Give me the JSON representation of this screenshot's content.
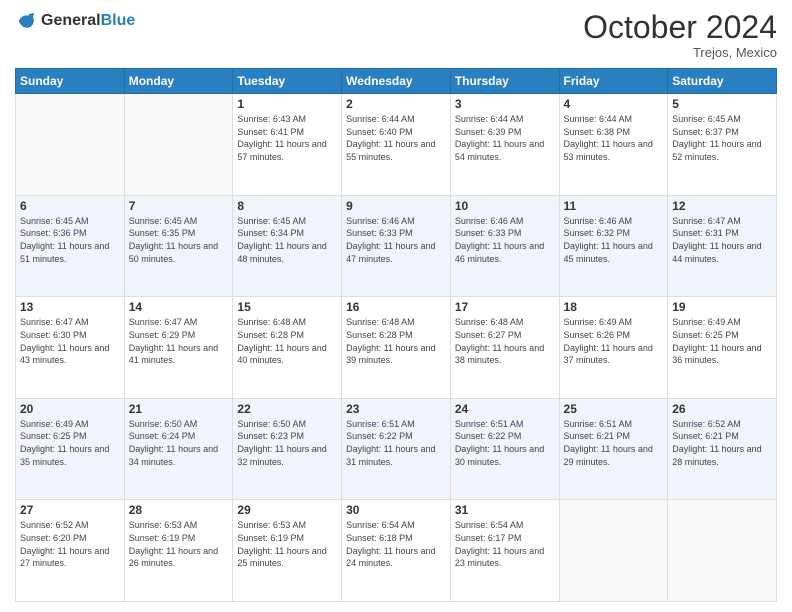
{
  "logo": {
    "general": "General",
    "blue": "Blue"
  },
  "header": {
    "month": "October 2024",
    "location": "Trejos, Mexico"
  },
  "weekdays": [
    "Sunday",
    "Monday",
    "Tuesday",
    "Wednesday",
    "Thursday",
    "Friday",
    "Saturday"
  ],
  "weeks": [
    [
      {
        "day": "",
        "sunrise": "",
        "sunset": "",
        "daylight": ""
      },
      {
        "day": "",
        "sunrise": "",
        "sunset": "",
        "daylight": ""
      },
      {
        "day": "1",
        "sunrise": "Sunrise: 6:43 AM",
        "sunset": "Sunset: 6:41 PM",
        "daylight": "Daylight: 11 hours and 57 minutes."
      },
      {
        "day": "2",
        "sunrise": "Sunrise: 6:44 AM",
        "sunset": "Sunset: 6:40 PM",
        "daylight": "Daylight: 11 hours and 55 minutes."
      },
      {
        "day": "3",
        "sunrise": "Sunrise: 6:44 AM",
        "sunset": "Sunset: 6:39 PM",
        "daylight": "Daylight: 11 hours and 54 minutes."
      },
      {
        "day": "4",
        "sunrise": "Sunrise: 6:44 AM",
        "sunset": "Sunset: 6:38 PM",
        "daylight": "Daylight: 11 hours and 53 minutes."
      },
      {
        "day": "5",
        "sunrise": "Sunrise: 6:45 AM",
        "sunset": "Sunset: 6:37 PM",
        "daylight": "Daylight: 11 hours and 52 minutes."
      }
    ],
    [
      {
        "day": "6",
        "sunrise": "Sunrise: 6:45 AM",
        "sunset": "Sunset: 6:36 PM",
        "daylight": "Daylight: 11 hours and 51 minutes."
      },
      {
        "day": "7",
        "sunrise": "Sunrise: 6:45 AM",
        "sunset": "Sunset: 6:35 PM",
        "daylight": "Daylight: 11 hours and 50 minutes."
      },
      {
        "day": "8",
        "sunrise": "Sunrise: 6:45 AM",
        "sunset": "Sunset: 6:34 PM",
        "daylight": "Daylight: 11 hours and 48 minutes."
      },
      {
        "day": "9",
        "sunrise": "Sunrise: 6:46 AM",
        "sunset": "Sunset: 6:33 PM",
        "daylight": "Daylight: 11 hours and 47 minutes."
      },
      {
        "day": "10",
        "sunrise": "Sunrise: 6:46 AM",
        "sunset": "Sunset: 6:33 PM",
        "daylight": "Daylight: 11 hours and 46 minutes."
      },
      {
        "day": "11",
        "sunrise": "Sunrise: 6:46 AM",
        "sunset": "Sunset: 6:32 PM",
        "daylight": "Daylight: 11 hours and 45 minutes."
      },
      {
        "day": "12",
        "sunrise": "Sunrise: 6:47 AM",
        "sunset": "Sunset: 6:31 PM",
        "daylight": "Daylight: 11 hours and 44 minutes."
      }
    ],
    [
      {
        "day": "13",
        "sunrise": "Sunrise: 6:47 AM",
        "sunset": "Sunset: 6:30 PM",
        "daylight": "Daylight: 11 hours and 43 minutes."
      },
      {
        "day": "14",
        "sunrise": "Sunrise: 6:47 AM",
        "sunset": "Sunset: 6:29 PM",
        "daylight": "Daylight: 11 hours and 41 minutes."
      },
      {
        "day": "15",
        "sunrise": "Sunrise: 6:48 AM",
        "sunset": "Sunset: 6:28 PM",
        "daylight": "Daylight: 11 hours and 40 minutes."
      },
      {
        "day": "16",
        "sunrise": "Sunrise: 6:48 AM",
        "sunset": "Sunset: 6:28 PM",
        "daylight": "Daylight: 11 hours and 39 minutes."
      },
      {
        "day": "17",
        "sunrise": "Sunrise: 6:48 AM",
        "sunset": "Sunset: 6:27 PM",
        "daylight": "Daylight: 11 hours and 38 minutes."
      },
      {
        "day": "18",
        "sunrise": "Sunrise: 6:49 AM",
        "sunset": "Sunset: 6:26 PM",
        "daylight": "Daylight: 11 hours and 37 minutes."
      },
      {
        "day": "19",
        "sunrise": "Sunrise: 6:49 AM",
        "sunset": "Sunset: 6:25 PM",
        "daylight": "Daylight: 11 hours and 36 minutes."
      }
    ],
    [
      {
        "day": "20",
        "sunrise": "Sunrise: 6:49 AM",
        "sunset": "Sunset: 6:25 PM",
        "daylight": "Daylight: 11 hours and 35 minutes."
      },
      {
        "day": "21",
        "sunrise": "Sunrise: 6:50 AM",
        "sunset": "Sunset: 6:24 PM",
        "daylight": "Daylight: 11 hours and 34 minutes."
      },
      {
        "day": "22",
        "sunrise": "Sunrise: 6:50 AM",
        "sunset": "Sunset: 6:23 PM",
        "daylight": "Daylight: 11 hours and 32 minutes."
      },
      {
        "day": "23",
        "sunrise": "Sunrise: 6:51 AM",
        "sunset": "Sunset: 6:22 PM",
        "daylight": "Daylight: 11 hours and 31 minutes."
      },
      {
        "day": "24",
        "sunrise": "Sunrise: 6:51 AM",
        "sunset": "Sunset: 6:22 PM",
        "daylight": "Daylight: 11 hours and 30 minutes."
      },
      {
        "day": "25",
        "sunrise": "Sunrise: 6:51 AM",
        "sunset": "Sunset: 6:21 PM",
        "daylight": "Daylight: 11 hours and 29 minutes."
      },
      {
        "day": "26",
        "sunrise": "Sunrise: 6:52 AM",
        "sunset": "Sunset: 6:21 PM",
        "daylight": "Daylight: 11 hours and 28 minutes."
      }
    ],
    [
      {
        "day": "27",
        "sunrise": "Sunrise: 6:52 AM",
        "sunset": "Sunset: 6:20 PM",
        "daylight": "Daylight: 11 hours and 27 minutes."
      },
      {
        "day": "28",
        "sunrise": "Sunrise: 6:53 AM",
        "sunset": "Sunset: 6:19 PM",
        "daylight": "Daylight: 11 hours and 26 minutes."
      },
      {
        "day": "29",
        "sunrise": "Sunrise: 6:53 AM",
        "sunset": "Sunset: 6:19 PM",
        "daylight": "Daylight: 11 hours and 25 minutes."
      },
      {
        "day": "30",
        "sunrise": "Sunrise: 6:54 AM",
        "sunset": "Sunset: 6:18 PM",
        "daylight": "Daylight: 11 hours and 24 minutes."
      },
      {
        "day": "31",
        "sunrise": "Sunrise: 6:54 AM",
        "sunset": "Sunset: 6:17 PM",
        "daylight": "Daylight: 11 hours and 23 minutes."
      },
      {
        "day": "",
        "sunrise": "",
        "sunset": "",
        "daylight": ""
      },
      {
        "day": "",
        "sunrise": "",
        "sunset": "",
        "daylight": ""
      }
    ]
  ]
}
